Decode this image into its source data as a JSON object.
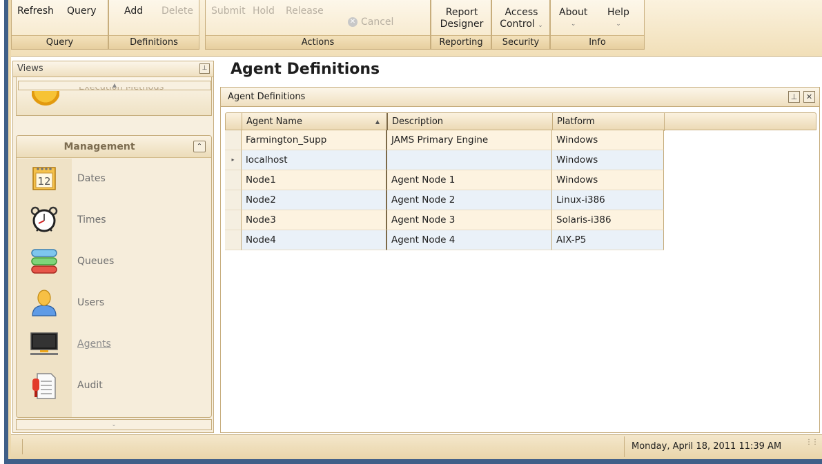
{
  "ribbon": {
    "groups": {
      "query": {
        "caption": "Query",
        "refresh": "Refresh",
        "query": "Query"
      },
      "definitions": {
        "caption": "Definitions",
        "add": "Add",
        "delete": "Delete"
      },
      "actions": {
        "caption": "Actions",
        "submit": "Submit",
        "hold": "Hold",
        "release": "Release",
        "cancel": "Cancel"
      },
      "reporting": {
        "caption": "Reporting",
        "report_designer_line1": "Report",
        "report_designer_line2": "Designer"
      },
      "security": {
        "caption": "Security",
        "access_control_line1": "Access",
        "access_control_line2": "Control"
      },
      "info": {
        "caption": "Info",
        "about": "About",
        "help": "Help"
      }
    }
  },
  "views": {
    "title": "Views",
    "pin_icon": "pin-icon",
    "execution_methods_label": "Execution Methods",
    "management": {
      "title": "Management",
      "items": [
        {
          "label": "Dates",
          "icon": "calendar-icon",
          "calendar_day": "12"
        },
        {
          "label": "Times",
          "icon": "alarm-clock-icon"
        },
        {
          "label": "Queues",
          "icon": "queues-icon"
        },
        {
          "label": "Users",
          "icon": "user-icon"
        },
        {
          "label": "Agents",
          "icon": "monitor-icon"
        },
        {
          "label": "Audit",
          "icon": "audit-document-icon"
        }
      ]
    }
  },
  "main": {
    "page_title": "Agent Definitions",
    "panel_title": "Agent Definitions",
    "grid": {
      "columns": [
        "Agent Name",
        "Description",
        "Platform"
      ],
      "rows": [
        {
          "name": "Farmington_Supp",
          "description": "JAMS Primary Engine",
          "platform": "Windows"
        },
        {
          "name": "localhost",
          "description": "",
          "platform": "Windows",
          "current": true
        },
        {
          "name": "Node1",
          "description": "Agent Node 1",
          "platform": "Windows"
        },
        {
          "name": "Node2",
          "description": "Agent Node 2",
          "platform": "Linux-i386"
        },
        {
          "name": "Node3",
          "description": "Agent Node 3",
          "platform": "Solaris-i386"
        },
        {
          "name": "Node4",
          "description": "Agent Node 4",
          "platform": "AIX-P5"
        }
      ]
    }
  },
  "statusbar": {
    "datetime": "Monday, April 18, 2011  11:39 AM"
  },
  "colors": {
    "ribbon_bg": "#f1dfb8",
    "row_odd": "#fdf3e0",
    "row_even": "#eaf1f8",
    "border": "#c6ad7d",
    "window_frame": "#3f5f88"
  }
}
